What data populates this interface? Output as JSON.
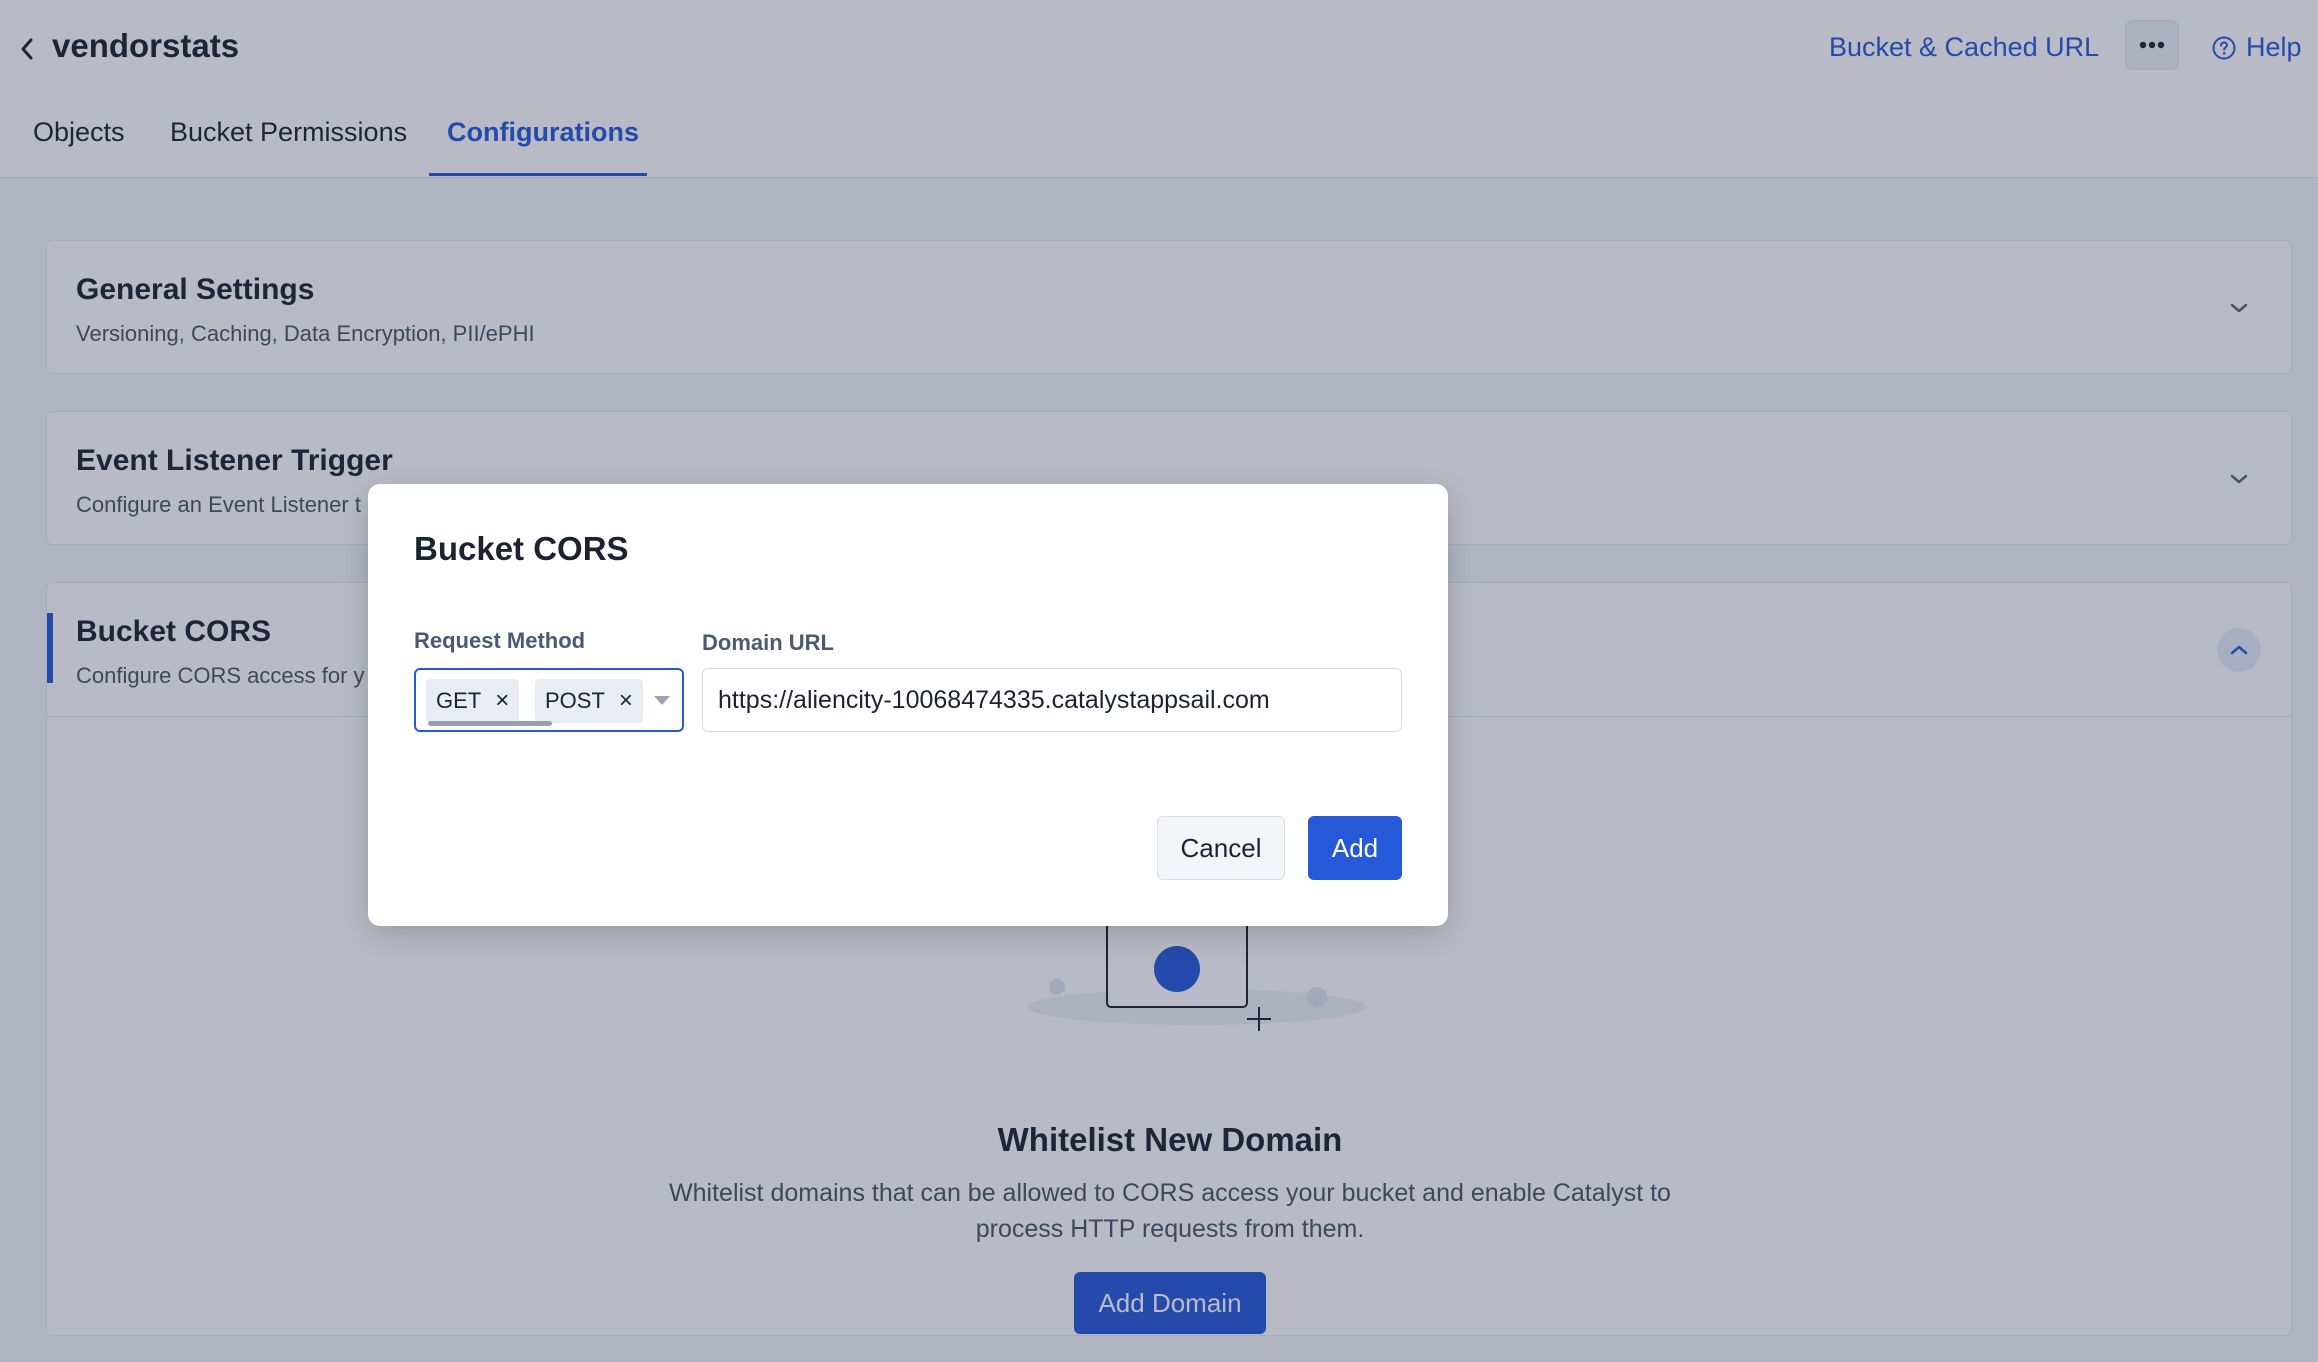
{
  "header": {
    "bucket_name": "vendorstats",
    "bucket_url_label": "Bucket & Cached URL",
    "help_label": "Help",
    "icons": {
      "back": "chevron-left-icon",
      "more": "ellipsis-icon",
      "help": "question-circle-icon"
    }
  },
  "tabs": [
    {
      "label": "Objects",
      "active": false
    },
    {
      "label": "Bucket Permissions",
      "active": false
    },
    {
      "label": "Configurations",
      "active": true
    }
  ],
  "sections": {
    "general": {
      "title": "General Settings",
      "subtitle": "Versioning, Caching, Data Encryption, PII/ePHI",
      "expanded": false
    },
    "event": {
      "title": "Event Listener Trigger",
      "subtitle": "Configure an Event Listener t",
      "expanded": false
    },
    "cors": {
      "title": "Bucket CORS",
      "subtitle": "Configure CORS access for y",
      "expanded": true,
      "empty_title": "Whitelist New Domain",
      "empty_desc_line1": "Whitelist domains that can be allowed to CORS access your bucket and enable Catalyst to",
      "empty_desc_line2": "process HTTP requests from them.",
      "add_domain_label": "Add Domain"
    }
  },
  "modal": {
    "title": "Bucket CORS",
    "method_label": "Request Method",
    "methods": [
      "GET",
      "POST"
    ],
    "remove_glyph": "×",
    "domain_label": "Domain URL",
    "domain_value": "https://aliencity-10068474335.catalystappsail.com",
    "cancel_label": "Cancel",
    "add_label": "Add"
  },
  "colors": {
    "accent": "#2659d9",
    "text": "#1b2333",
    "muted": "#4a5568",
    "overlay": "rgba(34,44,74,0.32)"
  }
}
